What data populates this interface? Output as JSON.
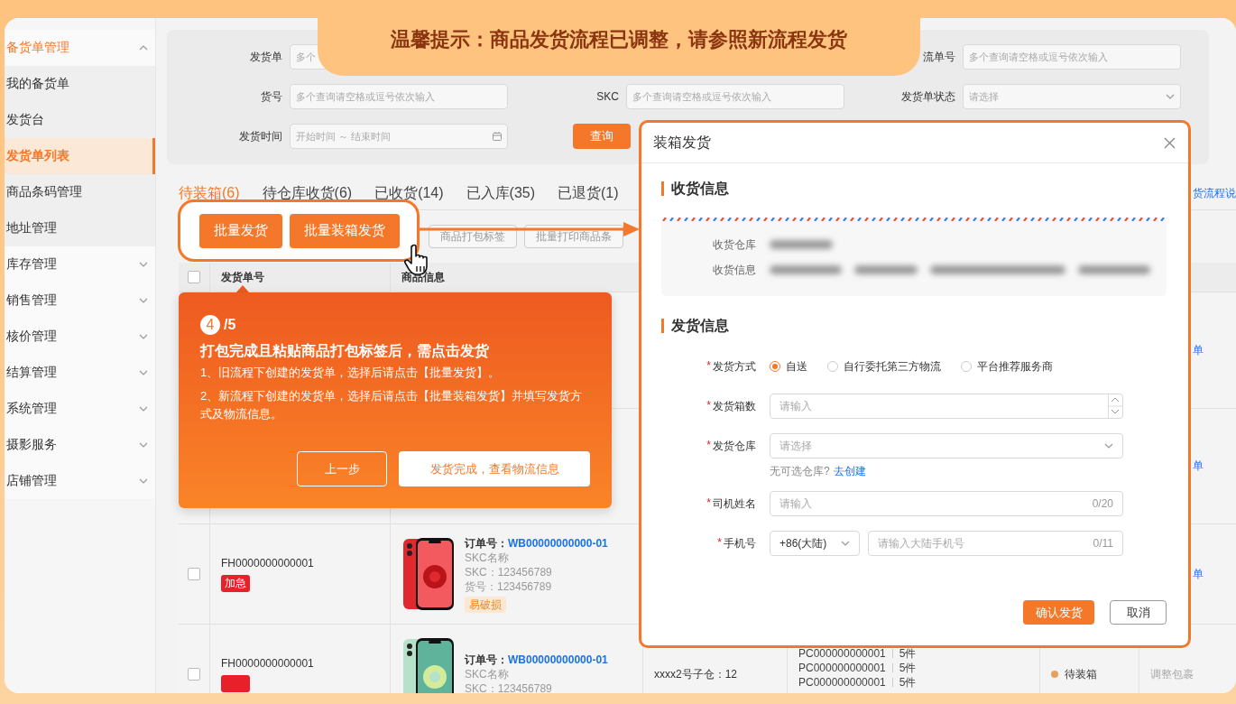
{
  "banner": {
    "text": "温馨提示：商品发货流程已调整，请参照新流程发货"
  },
  "sidebar": {
    "groups": [
      {
        "label": "备货单管理",
        "expanded": true,
        "children": [
          {
            "label": "我的备货单",
            "selected": false
          },
          {
            "label": "发货台",
            "selected": false
          },
          {
            "label": "发货单列表",
            "selected": true
          },
          {
            "label": "商品条码管理",
            "selected": false
          },
          {
            "label": "地址管理",
            "selected": false
          }
        ]
      },
      {
        "label": "库存管理",
        "expanded": false
      },
      {
        "label": "销售管理",
        "expanded": false
      },
      {
        "label": "核价管理",
        "expanded": false
      },
      {
        "label": "结算管理",
        "expanded": false
      },
      {
        "label": "系统管理",
        "expanded": false
      },
      {
        "label": "摄影服务",
        "expanded": false
      },
      {
        "label": "店铺管理",
        "expanded": false
      }
    ]
  },
  "filters": [
    [
      {
        "kind": "text",
        "label": "发货单",
        "placeholder": "多个"
      },
      {
        "kind": "text",
        "label": "流单号",
        "placeholder": "多个查询请空格或逗号依次输入"
      }
    ],
    [
      {
        "kind": "text",
        "label": "货号",
        "placeholder": "多个查询请空格或逗号依次输入"
      },
      {
        "kind": "text",
        "label": "SKC",
        "placeholder": "多个查询请空格或逗号依次输入"
      },
      {
        "kind": "select",
        "label": "发货单状态",
        "placeholder": "请选择"
      }
    ],
    [
      {
        "kind": "date",
        "label": "发货时间",
        "placeholder": "开始时间 ～ 结束时间"
      },
      {
        "kind": "button",
        "label": "查询"
      }
    ]
  ],
  "tabs": [
    {
      "label": "待装箱(6)",
      "selected": true
    },
    {
      "label": "待仓库收货(6)",
      "selected": false
    },
    {
      "label": "已收货(14)",
      "selected": false
    },
    {
      "label": "已入库(35)",
      "selected": false
    },
    {
      "label": "已退货(1)",
      "selected": false
    }
  ],
  "tabs_link": "货流程说",
  "toolbar": [
    "商品打包标签",
    "批量打印商品条"
  ],
  "table": {
    "header_checked": false,
    "columns": [
      "发货单号",
      "商品信息"
    ],
    "rows": [
      {
        "action": {
          "text": "单",
          "kind": "link"
        }
      },
      {
        "action": {
          "text": "单",
          "kind": "link"
        }
      },
      {
        "checked": false,
        "id": "FH0000000000001",
        "urgent": true,
        "tag": "加急",
        "product": {
          "order_label": "订单号：",
          "order_no": "WB00000000000-01",
          "lines": [
            "SKC名称",
            "SKC：123456789",
            "货号：123456789"
          ],
          "tag": "易破损"
        },
        "action": {
          "text": "单",
          "kind": "link"
        }
      },
      {
        "checked": false,
        "id": "FH0000000000001",
        "urgent": true,
        "product": {
          "order_label": "订单号：",
          "order_no": "WB00000000000-01",
          "lines": [
            "SKC名称",
            "SKC：123456789"
          ]
        },
        "warehouse": "xxxx2号子仓：12",
        "batches": [
          {
            "code": "PC000000000001",
            "qty": "5件"
          },
          {
            "code": "PC000000000001",
            "qty": "5件"
          },
          {
            "code": "PC000000000001",
            "qty": "5件"
          }
        ],
        "status": {
          "label": "待装箱",
          "color": "#e8a060"
        },
        "action": {
          "text": "调整包裹",
          "kind": "muted"
        }
      }
    ]
  },
  "callout": {
    "buttons": [
      "批量发货",
      "批量装箱发货"
    ]
  },
  "tooltip": {
    "step": "4",
    "total": "/5",
    "title": "打包完成且粘贴商品打包标签后，需点击发货",
    "lines": [
      "1、旧流程下创建的发货单，选择后请点击【批量发货】。",
      "2、新流程下创建的发货单，选择后请点击【批量装箱发货】并填写发货方式及物流信息。"
    ],
    "buttons": [
      {
        "label": "上一步",
        "kind": "outline"
      },
      {
        "label": "发货完成，查看物流信息",
        "kind": "solid"
      }
    ]
  },
  "dialog": {
    "title": "装箱发货",
    "receive": {
      "title": "收货信息",
      "rows": [
        {
          "label": "收货仓库"
        },
        {
          "label": "收货信息"
        }
      ]
    },
    "ship": {
      "title": "发货信息",
      "fields": [
        {
          "kind": "radio",
          "mark": "*",
          "label": "发货方式",
          "options": [
            {
              "label": "自送",
              "selected": true
            },
            {
              "label": "自行委托第三方物流",
              "selected": false
            },
            {
              "label": "平台推荐服务商",
              "selected": false
            }
          ]
        },
        {
          "kind": "number",
          "mark": "*",
          "label": "发货箱数",
          "placeholder": "请输入"
        },
        {
          "kind": "select",
          "mark": "*",
          "label": "发货仓库",
          "placeholder": "请选择",
          "hint": "无可选仓库?",
          "hint_link": "去创建"
        },
        {
          "kind": "text",
          "mark": "*",
          "label": "司机姓名",
          "placeholder": "请输入",
          "counter": "0/20"
        },
        {
          "kind": "phone",
          "mark": "*",
          "label": "手机号",
          "code": "+86(大陆)",
          "placeholder": "请输入大陆手机号",
          "counter": "0/11"
        }
      ]
    },
    "buttons": [
      {
        "label": "确认发货",
        "kind": "primary"
      },
      {
        "label": "取消",
        "kind": "default"
      }
    ]
  }
}
